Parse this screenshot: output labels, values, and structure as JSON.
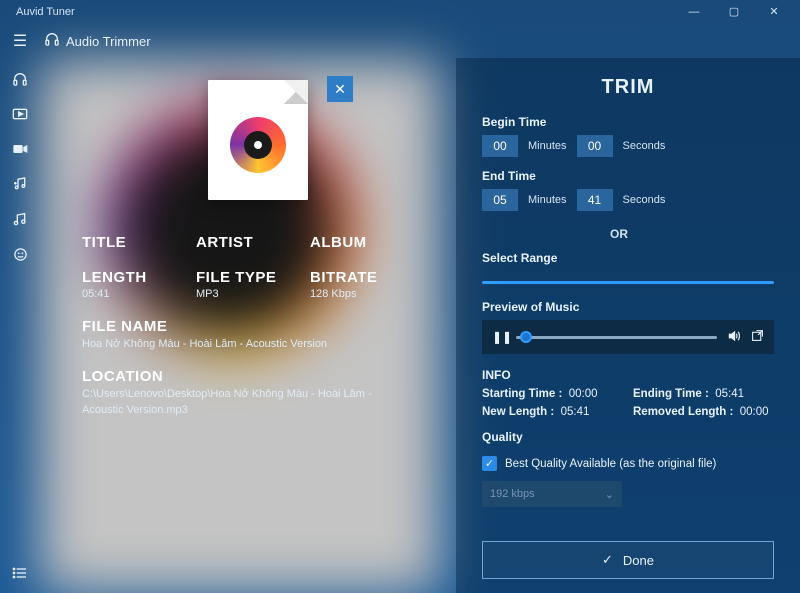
{
  "app_title": "Auvid Tuner",
  "page_label": "Audio Trimmer",
  "window_controls": {
    "min": "—",
    "max": "▢",
    "close": "✕"
  },
  "sidebar_icons": [
    "headphones",
    "video-rect",
    "video-cam",
    "music-transfer",
    "music-notes",
    "smile"
  ],
  "close_thumb": "✕",
  "meta": {
    "title_label": "TITLE",
    "artist_label": "ARTIST",
    "album_label": "ALBUM",
    "length_label": "LENGTH",
    "length_value": "05:41",
    "filetype_label": "FILE TYPE",
    "filetype_value": "MP3",
    "bitrate_label": "BITRATE",
    "bitrate_value": "128 Kbps",
    "filename_label": "FILE NAME",
    "filename_value": "Hoa Nở Không Màu - Hoài Lâm - Acoustic Version",
    "location_label": "LOCATION",
    "location_value": "C:\\Users\\Lenovo\\Desktop\\Hoa Nở Không Màu - Hoài Lâm - Acoustic Version.mp3"
  },
  "trim": {
    "title": "TRIM",
    "begin_label": "Begin Time",
    "begin_min": "00",
    "begin_sec": "00",
    "end_label": "End Time",
    "end_min": "05",
    "end_sec": "41",
    "minutes_label": "Minutes",
    "seconds_label": "Seconds",
    "or_label": "OR",
    "select_range_label": "Select Range",
    "preview_label": "Preview of Music",
    "info_label": "INFO",
    "starting_time_label": "Starting Time :",
    "starting_time_value": "00:00",
    "ending_time_label": "Ending Time :",
    "ending_time_value": "05:41",
    "new_length_label": "New Length :",
    "new_length_value": "05:41",
    "removed_length_label": "Removed Length :",
    "removed_length_value": "00:00",
    "quality_label": "Quality",
    "quality_checkbox_label": "Best Quality Available (as the original file)",
    "quality_select_value": "192 kbps",
    "done_label": "Done"
  }
}
